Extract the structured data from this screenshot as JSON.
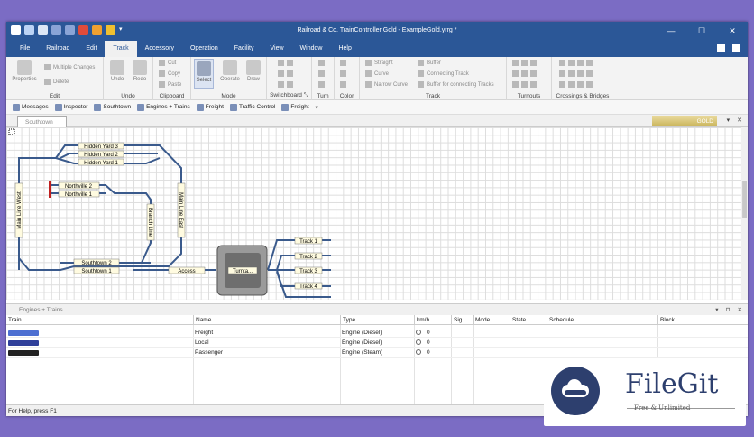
{
  "title": "Railroad & Co. TrainController Gold - ExampleGold.yrrg *",
  "window_controls": {
    "minimize": "—",
    "maximize": "☐",
    "close": "✕"
  },
  "menu": [
    "File",
    "Railroad",
    "Edit",
    "Track",
    "Accessory",
    "Operation",
    "Facility",
    "View",
    "Window",
    "Help"
  ],
  "ribbon": {
    "groups": [
      {
        "label": "Edit",
        "buttons": [
          "Properties"
        ],
        "rows": [
          "Multiple Changes",
          "Delete"
        ]
      },
      {
        "label": "Undo",
        "buttons": [
          "Undo",
          "Redo"
        ]
      },
      {
        "label": "Clipboard",
        "rows": [
          "Cut",
          "Copy",
          "Paste"
        ]
      },
      {
        "label": "Mode",
        "buttons": [
          "Select",
          "Operate",
          "Draw"
        ]
      },
      {
        "label": "Switchboard",
        "label_suffix": "⤡"
      },
      {
        "label": "Turn"
      },
      {
        "label": "Color"
      },
      {
        "label": "Track",
        "rows": [
          "Straight",
          "Curve",
          "Narrow Curve",
          "Buffer",
          "Connecting Track",
          "Buffer for connecting Tracks"
        ]
      },
      {
        "label": "Turnouts"
      },
      {
        "label": "Crossings & Bridges"
      }
    ]
  },
  "toolbar": [
    "Messages",
    "Inspector",
    "Southtown",
    "Engines + Trains",
    "Freight",
    "Traffic Control",
    "Freight"
  ],
  "doc_tab": "Southtown",
  "gold_badge": "GOLD",
  "doc_controls": {
    "pin": "▾",
    "close": "✕"
  },
  "panel": {
    "title": "Engines + Trains",
    "controls": [
      "▾",
      "⊓",
      "✕"
    ]
  },
  "table": {
    "headers": [
      "Train",
      "Name",
      "Type",
      "km/h",
      "Sig.",
      "Mode",
      "State",
      "Schedule",
      "Block"
    ],
    "rows": [
      {
        "name": "Freight",
        "type": "Engine (Diesel)",
        "speed": "0",
        "loco_color": "#4d6fd1"
      },
      {
        "name": "Local",
        "type": "Engine (Diesel)",
        "speed": "0",
        "loco_color": "#2f3f9a"
      },
      {
        "name": "Passenger",
        "type": "Engine (Steam)",
        "speed": "0",
        "loco_color": "#222222"
      }
    ]
  },
  "status_text": "For Help, press F1",
  "track_labels": {
    "hy3": "Hidden Yard 3",
    "hy2": "Hidden Yard 2",
    "hy1": "Hidden Yard 1",
    "nv2": "Northville 2",
    "nv1": "Northville 1",
    "mlw": "Main Line West",
    "mle": "Main Line East",
    "bl": "Branch Line",
    "st2": "Southtown 2",
    "st1": "Southtown 1",
    "access": "Access",
    "turntable": "Turnta...",
    "t1": "Track 1",
    "t2": "Track 2",
    "t3": "Track 3",
    "t4": "Track 4"
  },
  "watermark": {
    "name": "FileGit",
    "tagline": "Free & Unlimited"
  }
}
